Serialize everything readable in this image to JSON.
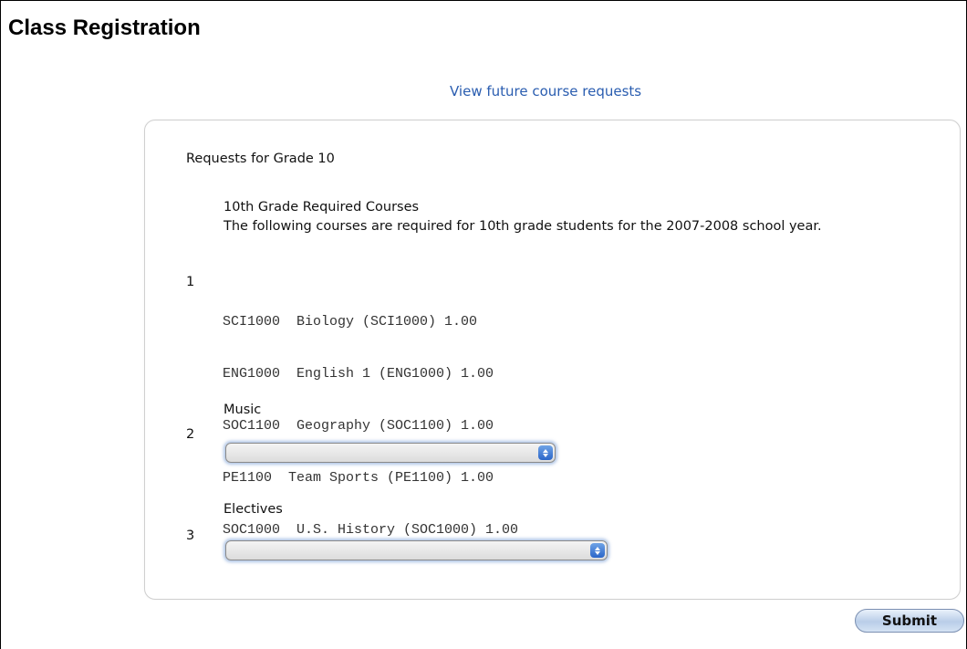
{
  "page": {
    "title": "Class Registration"
  },
  "links": {
    "future_requests": "View future course requests"
  },
  "requests": {
    "heading": "Requests for Grade 10",
    "required": {
      "number": "1",
      "title": "10th Grade Required Courses",
      "description": "The following courses are required for 10th grade students for the 2007-2008 school year.",
      "courses": [
        "SCI1000  Biology (SCI1000) 1.00",
        "ENG1000  English 1 (ENG1000) 1.00",
        "SOC1100  Geography (SOC1100) 1.00",
        "PE1100  Team Sports (PE1100) 1.00",
        "SOC1000  U.S. History (SOC1000) 1.00"
      ]
    },
    "music": {
      "number": "2",
      "label": "Music",
      "selected": ""
    },
    "electives": {
      "number": "3",
      "label": "Electives",
      "selected": ""
    }
  },
  "actions": {
    "submit_label": "Submit"
  },
  "colors": {
    "link": "#2a5db0",
    "select_arrow": "#2b66c9",
    "panel_border": "#cfcfcf"
  },
  "icons": {
    "select_arrow": "up-down-arrows-icon"
  }
}
